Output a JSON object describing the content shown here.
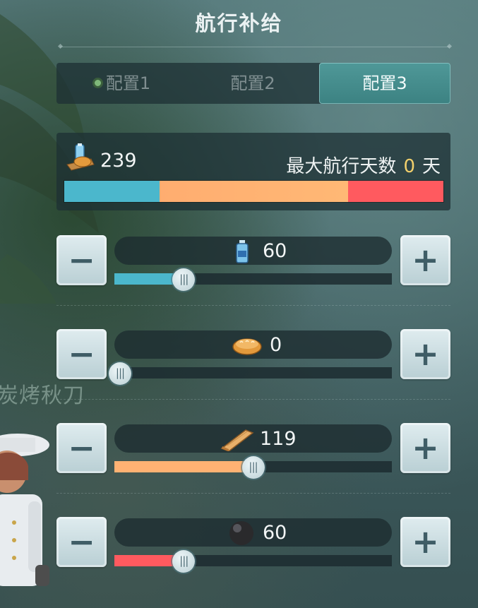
{
  "title": "航行补给",
  "background_text": "炭烤秋刀",
  "tabs": [
    {
      "label": "配置1",
      "active": false,
      "indicator": true
    },
    {
      "label": "配置2",
      "active": false
    },
    {
      "label": "配置3",
      "active": true
    }
  ],
  "summary": {
    "total": "239",
    "icon": "supplies-icon",
    "days_label": "最大航行天数",
    "days_value": "0",
    "days_unit": "天",
    "bar_segments": [
      {
        "name": "water",
        "value": 60,
        "color": "#4bb7cc"
      },
      {
        "name": "bread",
        "value": 0,
        "color": "#f3c27b"
      },
      {
        "name": "wood",
        "value": 119,
        "color": "#ffb273"
      },
      {
        "name": "cannonball",
        "value": 60,
        "color": "#ff5a5f"
      }
    ]
  },
  "rows": [
    {
      "name": "water",
      "icon": "water-bottle-icon",
      "value": "60",
      "level": 0.25,
      "color": "#4bb7cc",
      "minus": "−",
      "plus": "+"
    },
    {
      "name": "bread",
      "icon": "bread-icon",
      "value": "0",
      "level": 0.0,
      "color": "#f3c27b",
      "minus": "−",
      "plus": "+"
    },
    {
      "name": "wood",
      "icon": "wood-plank-icon",
      "value": "119",
      "level": 0.5,
      "color": "#ffb273",
      "minus": "−",
      "plus": "+"
    },
    {
      "name": "cannonball",
      "icon": "cannonball-icon",
      "value": "60",
      "level": 0.25,
      "color": "#ff5a5f",
      "minus": "−",
      "plus": "+"
    }
  ]
}
